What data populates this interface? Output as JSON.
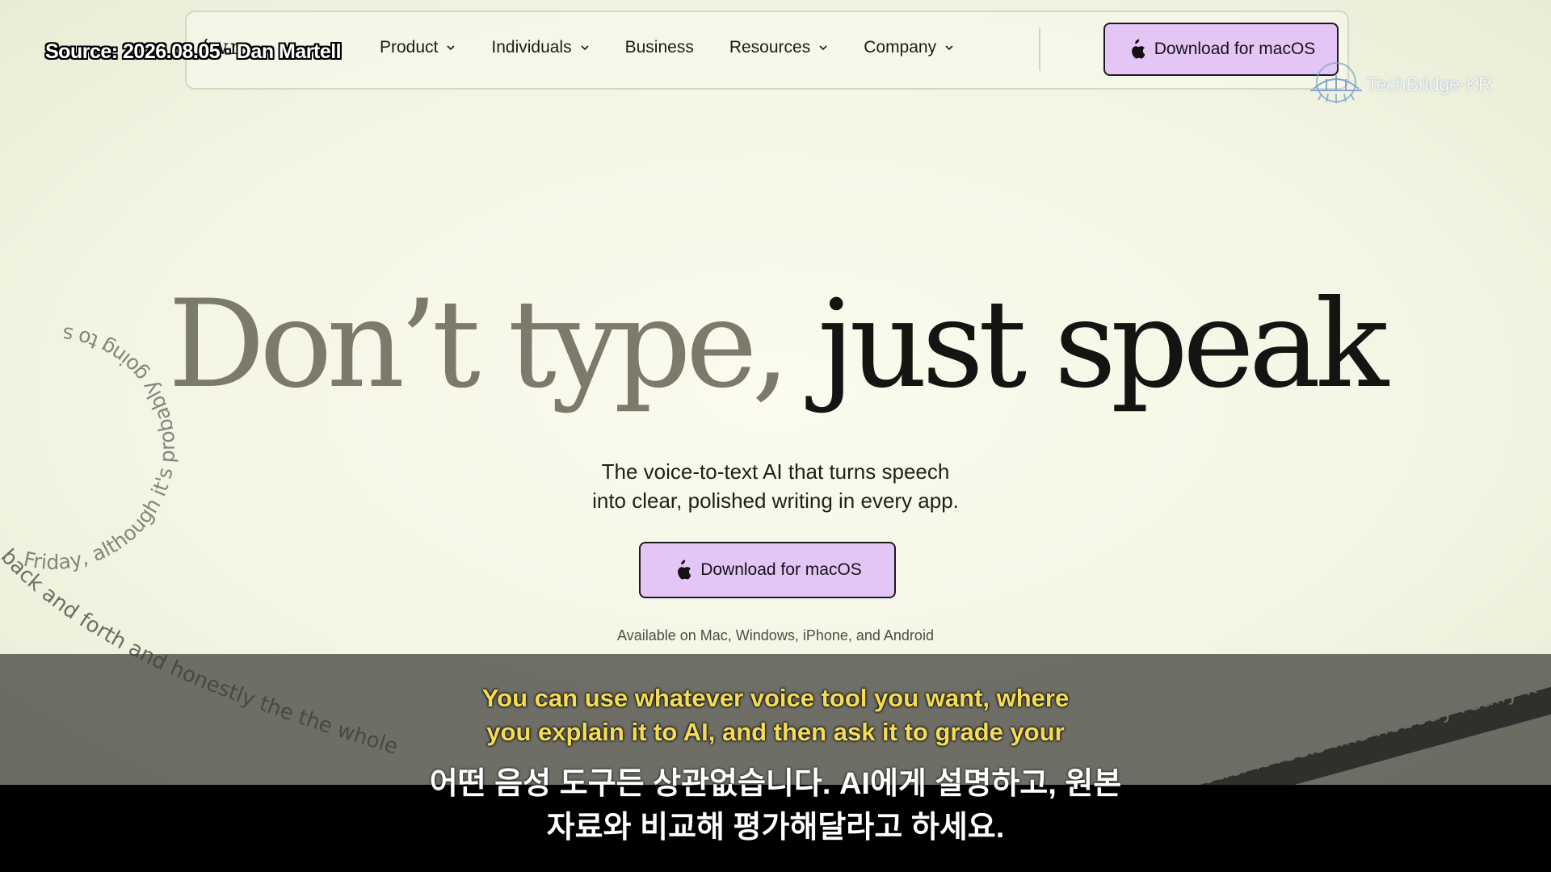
{
  "nav": {
    "logo_fragment": "‘wr",
    "items": [
      {
        "label": "Product",
        "dropdown": true
      },
      {
        "label": "Individuals",
        "dropdown": true
      },
      {
        "label": "Business",
        "dropdown": false
      },
      {
        "label": "Resources",
        "dropdown": true
      },
      {
        "label": "Company",
        "dropdown": true
      }
    ],
    "cta_label": "Download for macOS",
    "cta_icon": "apple-icon"
  },
  "hero": {
    "title_part1": "Don’t type,",
    "title_part2": "just speak",
    "subtitle_line1": "The voice-to-text AI that turns speech",
    "subtitle_line2": "into clear, polished writing in every app.",
    "cta_label": "Download for macOS",
    "availability": "Available on Mac, Windows, iPhone, and Android"
  },
  "decorative_text": {
    "circle": "Friday, although it's probably going to s",
    "arc_left": "back and forth and honestly the the whole",
    "ribbon_right": "chaotic. It feels like nobody really k"
  },
  "overlay": {
    "source": "Source: 2026.08.05 · Dan Martell",
    "watermark": "TechBridge-KR"
  },
  "captions": {
    "en_line1": "You can use whatever voice tool you want, where",
    "en_line2": "you explain it to AI, and then ask it to grade your",
    "ko_line1": "어떤 음성 도구든 상관없습니다. AI에게 설명하고, 원본",
    "ko_line2": "자료와 비교해 평가해달라고 하세요."
  },
  "colors": {
    "background": "#f6f6e8",
    "cta_fill": "#e4c6f6",
    "hero_grey": "#7b7a6b",
    "caption_yellow": "#f4dc55"
  }
}
